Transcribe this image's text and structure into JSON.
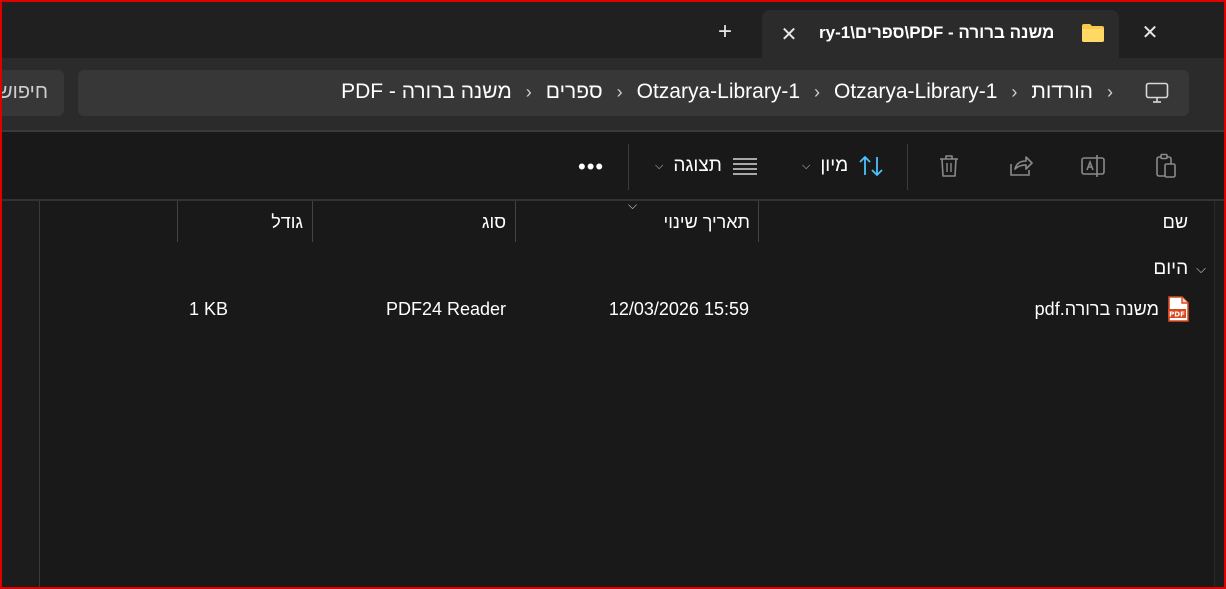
{
  "window": {
    "tab_title": "משנה ברורה - PDF\\ספרים\\ry-1",
    "tab_close_glyph": "✕",
    "window_close_glyph": "✕",
    "new_tab_glyph": "+"
  },
  "address_bar": {
    "icon": "computer-icon",
    "separator": "›",
    "crumbs": [
      "הורדות",
      "Otzarya-Library-1",
      "Otzarya-Library-1",
      "ספרים",
      "משנה ברורה - PDF"
    ]
  },
  "search": {
    "placeholder": "חיפוש"
  },
  "command_bar": {
    "icons": [
      "clipboard-icon",
      "rename-icon",
      "share-icon",
      "delete-icon"
    ],
    "sort_label": "מיון",
    "view_label": "תצוגה",
    "more_glyph": "•••"
  },
  "columns": {
    "name": "שם",
    "date_modified": "תאריך שינוי",
    "type": "סוג",
    "size": "גודל"
  },
  "group": {
    "label": "היום"
  },
  "files": [
    {
      "name": "משנה ברורה.pdf",
      "date_modified": "12/03/2026 15:59",
      "type": "PDF24 Reader",
      "size": "1 KB",
      "icon": "pdf-icon"
    }
  ],
  "colors": {
    "accent": "#4cc2ff",
    "folder": "#f8c948",
    "pdf": "#d9481f",
    "frame": "#e00000"
  }
}
